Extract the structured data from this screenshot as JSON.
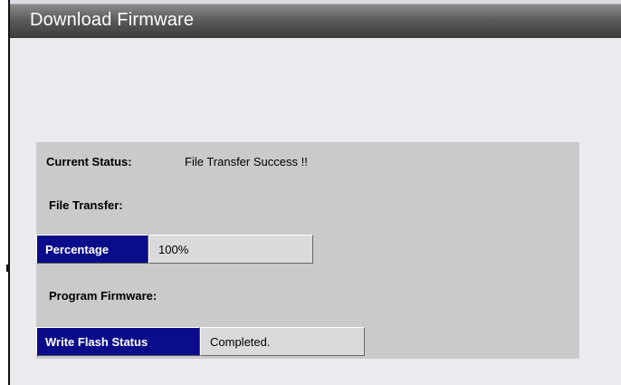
{
  "window": {
    "title": "Download Firmware"
  },
  "status": {
    "current_status_label": "Current Status:",
    "current_status_value": "File Transfer Success !!"
  },
  "file_transfer": {
    "section_label": "File Transfer:",
    "percentage_label": "Percentage",
    "percentage_value": "100%",
    "progress": 1.0
  },
  "program_firmware": {
    "section_label": "Program Firmware:",
    "write_flash_label": "Write Flash Status",
    "write_flash_value": "Completed."
  },
  "colors": {
    "title_bar": "#5c5c5c",
    "panel_background": "#cbc9cb",
    "label_background": "#0a0c8a",
    "value_background": "#dad9dc",
    "page_background": "#ebebef"
  }
}
